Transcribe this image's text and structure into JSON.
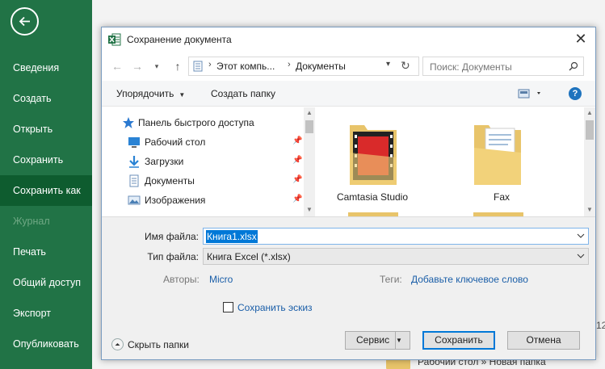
{
  "backstage": {
    "items": [
      {
        "label": "Сведения"
      },
      {
        "label": "Создать"
      },
      {
        "label": "Открыть"
      },
      {
        "label": "Сохранить"
      },
      {
        "label": "Сохранить как"
      },
      {
        "label": "Журнал"
      },
      {
        "label": "Печать"
      },
      {
        "label": "Общий доступ"
      },
      {
        "label": "Экспорт"
      },
      {
        "label": "Опубликовать"
      }
    ]
  },
  "background": {
    "partial_number": "12",
    "recent_path": "Рабочий стол » Новая папка"
  },
  "dialog": {
    "title": "Сохранение документа",
    "address": {
      "segment1": "Этот компь...",
      "segment2": "Документы"
    },
    "search_placeholder": "Поиск: Документы",
    "toolbar": {
      "organize": "Упорядочить",
      "new_folder": "Создать папку"
    },
    "nav": {
      "quick_access": "Панель быстрого доступа",
      "items": [
        {
          "label": "Рабочий стол",
          "icon": "desktop-icon"
        },
        {
          "label": "Загрузки",
          "icon": "downloads-icon"
        },
        {
          "label": "Документы",
          "icon": "documents-icon"
        },
        {
          "label": "Изображения",
          "icon": "pictures-icon"
        }
      ]
    },
    "files": [
      {
        "name": "Camtasia Studio",
        "icon": "camtasia-folder-icon"
      },
      {
        "name": "Fax",
        "icon": "fax-folder-icon"
      }
    ],
    "form": {
      "filename_label": "Имя файла:",
      "filename_value": "Книга1.xlsx",
      "filetype_label": "Тип файла:",
      "filetype_value": "Книга Excel (*.xlsx)",
      "authors_label": "Авторы:",
      "authors_value": "Micro",
      "tags_label": "Теги:",
      "tags_value": "Добавьте ключевое слово",
      "thumbnail_label": "Сохранить эскиз",
      "hide_folders": "Скрыть папки",
      "tools_button": "Сервис",
      "save_button": "Сохранить",
      "cancel_button": "Отмена"
    }
  },
  "colors": {
    "excel_green": "#217346",
    "excel_green_active": "#0e5c2f",
    "selection_blue": "#0078d7",
    "link_blue": "#1a5ea8"
  }
}
